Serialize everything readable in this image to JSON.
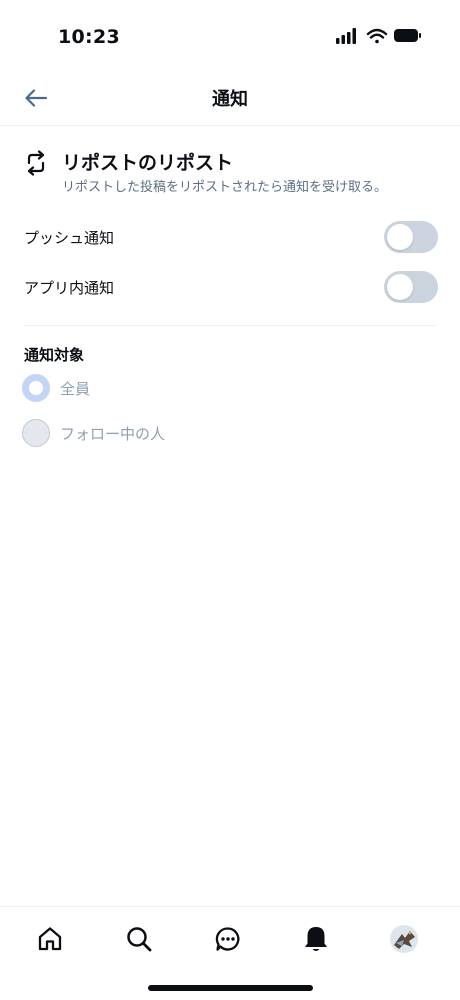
{
  "status_bar": {
    "time": "10:23"
  },
  "header": {
    "title": "通知",
    "back_icon": "arrow-left-icon"
  },
  "section": {
    "icon": "repost-icon",
    "title": "リポストのリポスト",
    "description": "リポストした投稿をリポストされたら通知を受け取る。"
  },
  "toggles": [
    {
      "label": "プッシュ通知",
      "enabled": false
    },
    {
      "label": "アプリ内通知",
      "enabled": false
    }
  ],
  "target": {
    "title": "通知対象",
    "options": [
      {
        "label": "全員",
        "selected": true
      },
      {
        "label": "フォロー中の人",
        "selected": false
      }
    ]
  },
  "tab_bar": {
    "items": [
      "home-icon",
      "search-icon",
      "chat-icon",
      "bell-icon",
      "avatar"
    ],
    "active": "bell-icon"
  },
  "colors": {
    "accent": "#c3d5f7",
    "toggle_off": "#cbd3de",
    "muted_text": "#8f9fb2",
    "description_text": "#5c6f86"
  }
}
